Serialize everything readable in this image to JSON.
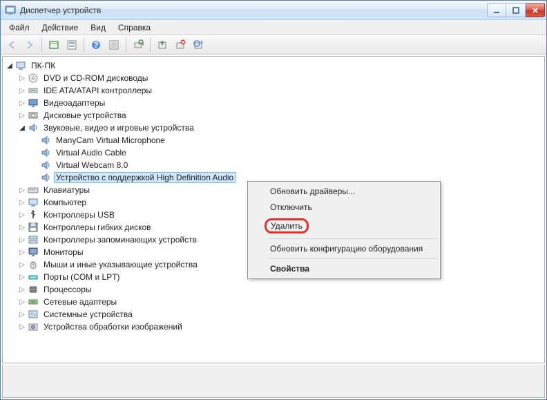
{
  "window": {
    "title": "Диспетчер устройств"
  },
  "menubar": {
    "items": [
      "Файл",
      "Действие",
      "Вид",
      "Справка"
    ]
  },
  "toolbar": {
    "buttons": [
      {
        "name": "back",
        "enabled": false
      },
      {
        "name": "forward",
        "enabled": false
      },
      {
        "name": "sep"
      },
      {
        "name": "show-hidden",
        "enabled": true
      },
      {
        "name": "properties",
        "enabled": true
      },
      {
        "name": "sep"
      },
      {
        "name": "help",
        "enabled": true
      },
      {
        "name": "details",
        "enabled": true
      },
      {
        "name": "sep"
      },
      {
        "name": "scan-hardware",
        "enabled": true
      },
      {
        "name": "sep"
      },
      {
        "name": "update-driver",
        "enabled": true
      },
      {
        "name": "uninstall-device",
        "enabled": true
      },
      {
        "name": "disable-device",
        "enabled": true
      }
    ]
  },
  "tree": {
    "root": {
      "label": "ПК-ПК",
      "icon": "computer",
      "expanded": true
    },
    "categories": [
      {
        "label": "DVD и CD-ROM дисководы",
        "icon": "disc",
        "expanded": false
      },
      {
        "label": "IDE ATA/ATAPI контроллеры",
        "icon": "ide",
        "expanded": false
      },
      {
        "label": "Видеоадаптеры",
        "icon": "display",
        "expanded": false
      },
      {
        "label": "Дисковые устройства",
        "icon": "hdd",
        "expanded": false
      },
      {
        "label": "Звуковые, видео и игровые устройства",
        "icon": "sound",
        "expanded": true,
        "children": [
          {
            "label": "ManyCam Virtual Microphone",
            "icon": "sound"
          },
          {
            "label": "Virtual Audio Cable",
            "icon": "sound"
          },
          {
            "label": "Virtual Webcam 8.0",
            "icon": "sound"
          },
          {
            "label": "Устройство с поддержкой High Definition Audio",
            "icon": "sound",
            "selected": true
          }
        ]
      },
      {
        "label": "Клавиатуры",
        "icon": "keyboard",
        "expanded": false
      },
      {
        "label": "Компьютер",
        "icon": "computer",
        "expanded": false
      },
      {
        "label": "Контроллеры USB",
        "icon": "usb",
        "expanded": false
      },
      {
        "label": "Контроллеры гибких дисков",
        "icon": "floppy",
        "expanded": false
      },
      {
        "label": "Контроллеры запоминающих устройств",
        "icon": "storage",
        "expanded": false
      },
      {
        "label": "Мониторы",
        "icon": "monitor",
        "expanded": false
      },
      {
        "label": "Мыши и иные указывающие устройства",
        "icon": "mouse",
        "expanded": false
      },
      {
        "label": "Порты (COM и LPT)",
        "icon": "port",
        "expanded": false
      },
      {
        "label": "Процессоры",
        "icon": "cpu",
        "expanded": false
      },
      {
        "label": "Сетевые адаптеры",
        "icon": "network",
        "expanded": false
      },
      {
        "label": "Системные устройства",
        "icon": "system",
        "expanded": false
      },
      {
        "label": "Устройства обработки изображений",
        "icon": "imaging",
        "expanded": false
      }
    ]
  },
  "context_menu": {
    "items": [
      {
        "label": "Обновить драйверы...",
        "name": "update-drivers"
      },
      {
        "label": "Отключить",
        "name": "disable"
      },
      {
        "label": "Удалить",
        "name": "uninstall",
        "highlighted": true
      },
      {
        "sep": true
      },
      {
        "label": "Обновить конфигурацию оборудования",
        "name": "scan"
      },
      {
        "sep": true
      },
      {
        "label": "Свойства",
        "name": "properties",
        "bold": true
      }
    ]
  }
}
